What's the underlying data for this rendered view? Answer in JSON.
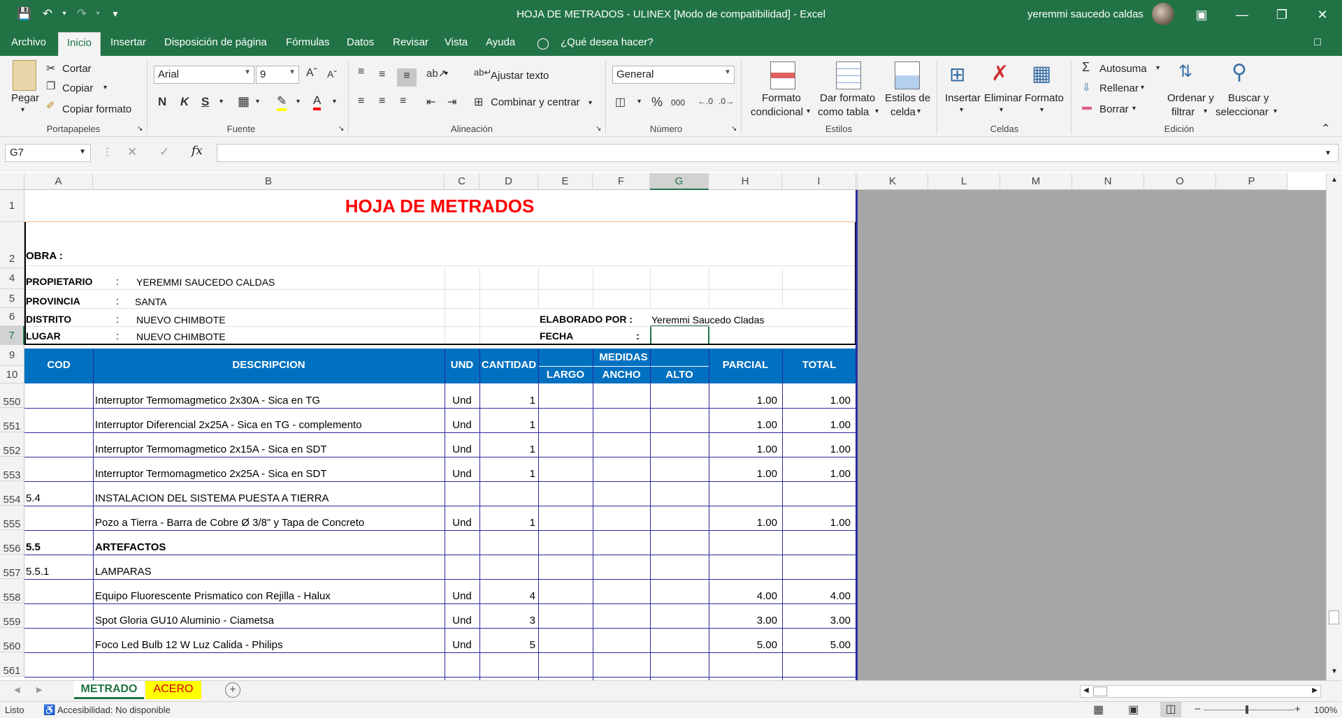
{
  "titlebar": {
    "title": "HOJA DE METRADOS - ULINEX  [Modo de compatibilidad]  -  Excel",
    "user": "yeremmi saucedo caldas"
  },
  "tabs": [
    "Archivo",
    "Inicio",
    "Insertar",
    "Disposición de página",
    "Fórmulas",
    "Datos",
    "Revisar",
    "Vista",
    "Ayuda",
    "¿Qué desea hacer?"
  ],
  "ribbon": {
    "portapapeles": {
      "pegar": "Pegar",
      "cortar": "Cortar",
      "copiar": "Copiar",
      "copiar_formato": "Copiar formato",
      "label": "Portapapeles"
    },
    "fuente": {
      "font": "Arial",
      "size": "9",
      "label": "Fuente",
      "bold": "N",
      "italic": "K",
      "underline": "S"
    },
    "alineacion": {
      "ajustar": "Ajustar texto",
      "combinar": "Combinar y centrar",
      "label": "Alineación"
    },
    "numero": {
      "format": "General",
      "label": "Número",
      "percent": "%",
      "thousands": "000"
    },
    "estilos": {
      "formato_cond_1": "Formato",
      "formato_cond_2": "condicional",
      "dar_formato_1": "Dar formato",
      "dar_formato_2": "como tabla",
      "estilos_celda_1": "Estilos de",
      "estilos_celda_2": "celda",
      "label": "Estilos"
    },
    "celdas": {
      "insertar": "Insertar",
      "eliminar": "Eliminar",
      "formato": "Formato",
      "label": "Celdas"
    },
    "edicion": {
      "autosuma": "Autosuma",
      "rellenar": "Rellenar",
      "borrar": "Borrar",
      "ordenar_1": "Ordenar y",
      "ordenar_2": "filtrar",
      "buscar_1": "Buscar y",
      "buscar_2": "seleccionar",
      "label": "Edición"
    }
  },
  "formula": {
    "namebox": "G7",
    "value": ""
  },
  "columns": [
    "A",
    "B",
    "C",
    "D",
    "E",
    "F",
    "G",
    "H",
    "I",
    "J",
    "K",
    "L",
    "M",
    "N",
    "O",
    "P"
  ],
  "sheet": {
    "title": "HOJA DE METRADOS",
    "obra": "OBRA  :",
    "propietario_label": "PROPIETARIO",
    "propietario": "YEREMMI SAUCEDO CALDAS",
    "provincia_label": "PROVINCIA",
    "provincia": "SANTA",
    "distrito_label": "DISTRITO",
    "distrito": "NUEVO CHIMBOTE",
    "lugar_label": "LUGAR",
    "lugar": "NUEVO CHIMBOTE",
    "colon": ":",
    "elaborado_label": "ELABORADO POR :",
    "elaborado": "Yeremmi Saucedo Cladas",
    "fecha_label": "FECHA",
    "fecha_colon": ":",
    "headers": {
      "cod": "COD",
      "descripcion": "DESCRIPCION",
      "und": "UND",
      "cantidad": "CANTIDAD",
      "medidas": "MEDIDAS",
      "largo": "LARGO",
      "ancho": "ANCHO",
      "alto": "ALTO",
      "parcial": "PARCIAL",
      "total": "TOTAL"
    }
  },
  "rows": [
    {
      "num": "550",
      "cod": "",
      "desc": "Interruptor Termomagmetico 2x30A - Sica en TG",
      "und": "Und",
      "cant": "1",
      "parcial": "1.00",
      "total": "1.00",
      "bold": false
    },
    {
      "num": "551",
      "cod": "",
      "desc": "Interruptor Diferencial 2x25A - Sica en TG - complemento",
      "und": "Und",
      "cant": "1",
      "parcial": "1.00",
      "total": "1.00",
      "bold": false
    },
    {
      "num": "552",
      "cod": "",
      "desc": "Interruptor Termomagmetico 2x15A - Sica en SDT",
      "und": "Und",
      "cant": "1",
      "parcial": "1.00",
      "total": "1.00",
      "bold": false
    },
    {
      "num": "553",
      "cod": "",
      "desc": "Interruptor Termomagmetico 2x25A - Sica en SDT",
      "und": "Und",
      "cant": "1",
      "parcial": "1.00",
      "total": "1.00",
      "bold": false
    },
    {
      "num": "554",
      "cod": "5.4",
      "desc": "INSTALACION DEL SISTEMA PUESTA A TIERRA",
      "und": "",
      "cant": "",
      "parcial": "",
      "total": "",
      "bold": false
    },
    {
      "num": "555",
      "cod": "",
      "desc": "Pozo a Tierra - Barra de Cobre Ø 3/8\" y Tapa de Concreto",
      "und": "Und",
      "cant": "1",
      "parcial": "1.00",
      "total": "1.00",
      "bold": false
    },
    {
      "num": "556",
      "cod": "5.5",
      "desc": "ARTEFACTOS",
      "und": "",
      "cant": "",
      "parcial": "",
      "total": "",
      "bold": true
    },
    {
      "num": "557",
      "cod": "5.5.1",
      "desc": "LAMPARAS",
      "und": "",
      "cant": "",
      "parcial": "",
      "total": "",
      "bold": false
    },
    {
      "num": "558",
      "cod": "",
      "desc": "Equipo Fluorescente Prismatico con Rejilla - Halux",
      "und": "Und",
      "cant": "4",
      "parcial": "4.00",
      "total": "4.00",
      "bold": false
    },
    {
      "num": "559",
      "cod": "",
      "desc": "Spot Gloria GU10 Aluminio - Ciametsa",
      "und": "Und",
      "cant": "3",
      "parcial": "3.00",
      "total": "3.00",
      "bold": false
    },
    {
      "num": "560",
      "cod": "",
      "desc": "Foco Led Bulb 12 W Luz Calida - Philips",
      "und": "Und",
      "cant": "5",
      "parcial": "5.00",
      "total": "5.00",
      "bold": false
    },
    {
      "num": "561",
      "cod": "",
      "desc": "",
      "und": "",
      "cant": "",
      "parcial": "",
      "total": "",
      "bold": false
    }
  ],
  "header_rows": [
    "1",
    "2",
    "4",
    "5",
    "6",
    "7",
    "9",
    "10"
  ],
  "sheettabs": [
    "METRADO",
    "ACERO"
  ],
  "status": {
    "listo": "Listo",
    "accesibilidad": "Accesibilidad: No disponible",
    "zoom": "100%",
    "plus": "+",
    "minus": "−"
  },
  "colors": {
    "excel_green": "#217346",
    "header_blue": "#0070c0",
    "title_red": "#ff0000",
    "tab_yellow": "#ffff00",
    "grey_area": "#a6a6a6"
  }
}
